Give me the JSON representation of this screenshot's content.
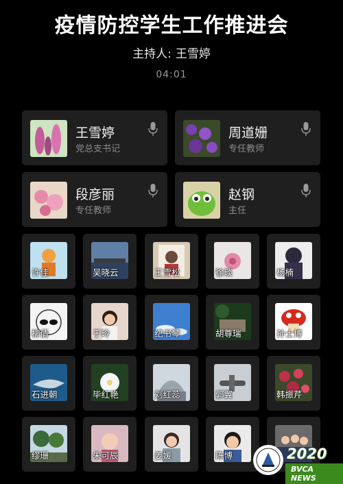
{
  "meeting": {
    "title": "疫情防控学生工作推进会",
    "host_label": "主持人:",
    "host_name": "王雪婷",
    "timer": "04:01"
  },
  "featured": [
    {
      "name": "王雪婷",
      "role": "党总支书记",
      "avatar": "foxglove-flowers",
      "mic": "microphone-icon"
    },
    {
      "name": "周道姗",
      "role": "专任教师",
      "avatar": "purple-flowers",
      "mic": "microphone-icon"
    },
    {
      "name": "段彦丽",
      "role": "专任教师",
      "avatar": "pink-blossoms",
      "mic": "microphone-icon"
    },
    {
      "name": "赵钢",
      "role": "主任",
      "avatar": "green-cartoon-frog",
      "mic": "microphone-icon"
    }
  ],
  "participants": [
    {
      "name": "许佳",
      "avatar": "cartoon-figure"
    },
    {
      "name": "吴晓云",
      "avatar": "lakeside-town"
    },
    {
      "name": "王雪松",
      "avatar": "portrait-photo"
    },
    {
      "name": "徐琰",
      "avatar": "pink-flower"
    },
    {
      "name": "杨楠",
      "avatar": "person-hat"
    },
    {
      "name": "柳倩",
      "avatar": "sketch-sunglasses"
    },
    {
      "name": "于玲",
      "avatar": "girl-portrait"
    },
    {
      "name": "纪书琴",
      "avatar": "blue-sky"
    },
    {
      "name": "胡尊瑞",
      "avatar": "tree-stone"
    },
    {
      "name": "孙士博",
      "avatar": "red-mushroom"
    },
    {
      "name": "石进朝",
      "avatar": "shark"
    },
    {
      "name": "毕红艳",
      "avatar": "white-flower"
    },
    {
      "name": "刘红蕊",
      "avatar": "dome-building"
    },
    {
      "name": "郭翼",
      "avatar": "airplane"
    },
    {
      "name": "韩振芹",
      "avatar": "red-flowers"
    },
    {
      "name": "缪珊",
      "avatar": "tropical-trees"
    },
    {
      "name": "朱可辰",
      "avatar": "child-portrait"
    },
    {
      "name": "姜媛",
      "avatar": "woman-portrait"
    },
    {
      "name": "陈博",
      "avatar": "boy-portrait"
    },
    {
      "name": "",
      "avatar": "group-photo"
    }
  ],
  "watermark": {
    "year": "2020",
    "brand": "BVCA NEWS",
    "seal_icon": "school-seal-icon"
  },
  "colors": {
    "background": "#000000",
    "tile": "#1f1f1f",
    "brand_green": "#3c8a1e"
  }
}
